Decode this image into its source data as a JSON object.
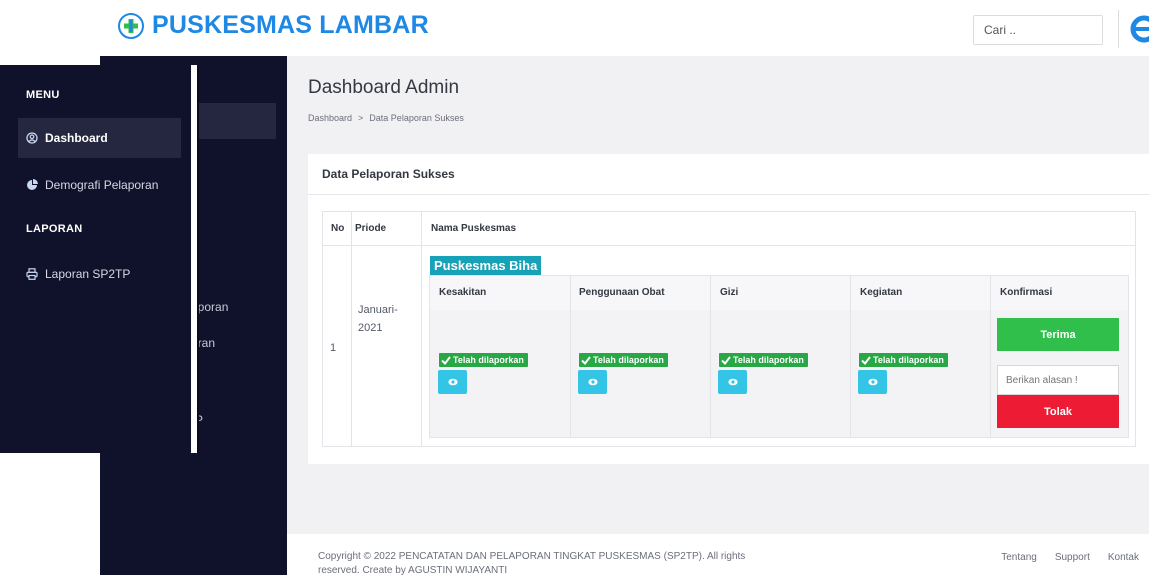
{
  "app": {
    "title": "PUSKESMAS LAMBAR"
  },
  "header": {
    "search_placeholder": "Cari .."
  },
  "sidebar": {
    "headings": [
      "MENU",
      "LAPORAN"
    ],
    "items": [
      {
        "label": "Dashboard",
        "icon": "user-circle-icon",
        "active": true
      },
      {
        "label": "Demografi Pelaporan",
        "icon": "pie-chart-icon",
        "active": false
      },
      {
        "label": "Laporan SP2TP",
        "icon": "printer-icon",
        "active": false
      }
    ],
    "ghost_labels": [
      "n",
      "aporan",
      "oran",
      "P"
    ]
  },
  "page": {
    "title": "Dashboard Admin",
    "breadcrumb": [
      "Dashboard",
      ">",
      "Data Pelaporan Sukses"
    ]
  },
  "card": {
    "title": "Data Pelaporan Sukses",
    "columns": [
      "No",
      "Priode",
      "Nama Puskesmas"
    ],
    "rows": [
      {
        "no": "1",
        "period_line1": "Januari-",
        "period_line2": "2021",
        "puskesmas": "Puskesmas Biha",
        "sub_columns": [
          "Kesakitan",
          "Penggunaan Obat",
          "Gizi",
          "Kegiatan",
          "Konfirmasi"
        ],
        "status": [
          "Telah dilaporkan",
          "Telah dilaporkan",
          "Telah dilaporkan",
          "Telah dilaporkan"
        ],
        "accept_label": "Terima",
        "reason_placeholder": "Berikan alasan !",
        "reject_label": "Tolak"
      }
    ]
  },
  "footer": {
    "copyright": "Copyright © 2022 PENCATATAN DAN PELAPORAN TINGKAT PUSKESMAS (SP2TP). All rights reserved. Create by AGUSTIN WIJAYANTI",
    "links": [
      "Tentang",
      "Support",
      "Kontak"
    ]
  },
  "colors": {
    "brand": "#1e88e5",
    "sidebar": "#10112b",
    "success": "#28a745",
    "info": "#33c4e6",
    "danger": "#ed1b34",
    "badge_teal": "#17a2b8"
  }
}
